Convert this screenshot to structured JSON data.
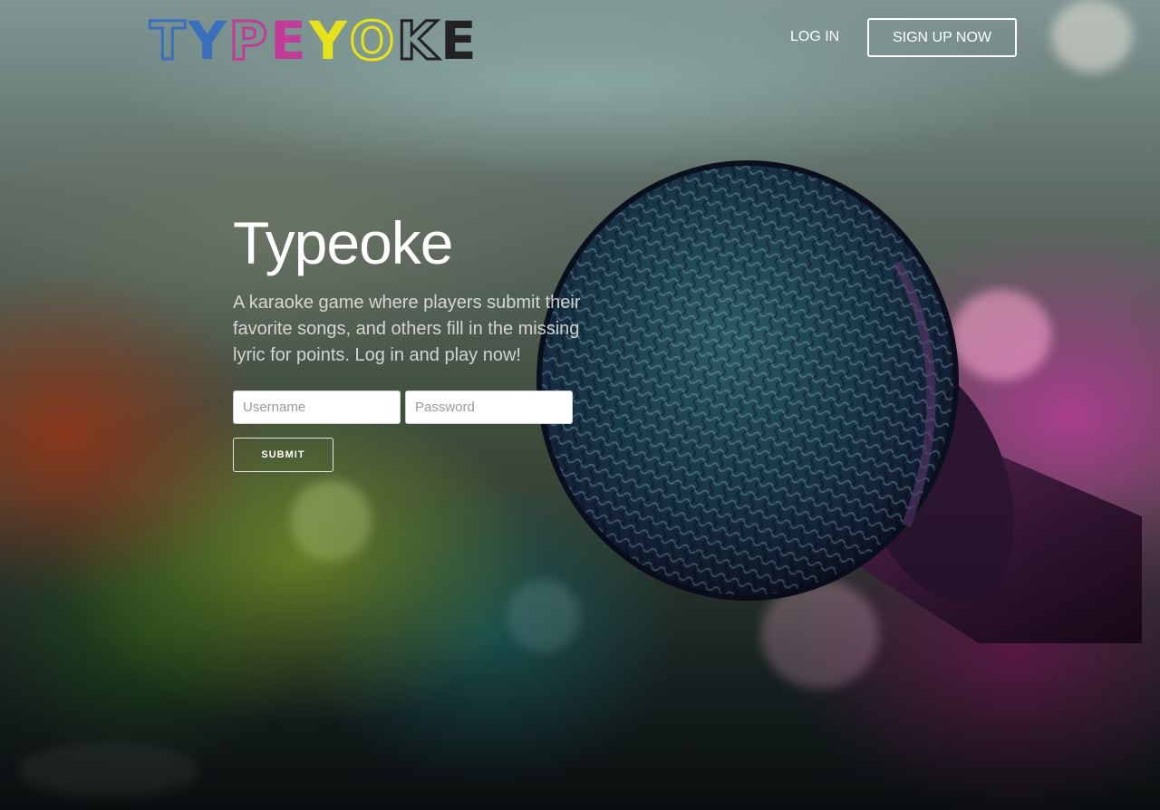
{
  "header": {
    "logo_letters": [
      {
        "char": "T",
        "style": "outline",
        "color": "#3a6fc0"
      },
      {
        "char": "Y",
        "style": "solid",
        "color": "#3a6fc0"
      },
      {
        "char": "P",
        "style": "outline",
        "color": "#c23b98"
      },
      {
        "char": "E",
        "style": "solid",
        "color": "#c23b98"
      },
      {
        "char": "Y",
        "style": "solid",
        "color": "#e6e21b"
      },
      {
        "char": "O",
        "style": "outline",
        "color": "#e6e21b"
      },
      {
        "char": "K",
        "style": "outline",
        "color": "#222222"
      },
      {
        "char": "E",
        "style": "solid",
        "color": "#222222"
      }
    ],
    "login_label": "LOG IN",
    "signup_label": "SIGN UP NOW"
  },
  "hero": {
    "title": "Typeoke",
    "description": "A karaoke game where players submit their favorite songs, and others fill in the missing lyric for points. Log in and play now!",
    "username_placeholder": "Username",
    "password_placeholder": "Password",
    "submit_label": "SUBMIT"
  },
  "background": {
    "subject": "microphone-photo",
    "tint_colors": [
      "#3a6fc0",
      "#c23b98",
      "#e6e21b",
      "#8a9c3a"
    ]
  }
}
